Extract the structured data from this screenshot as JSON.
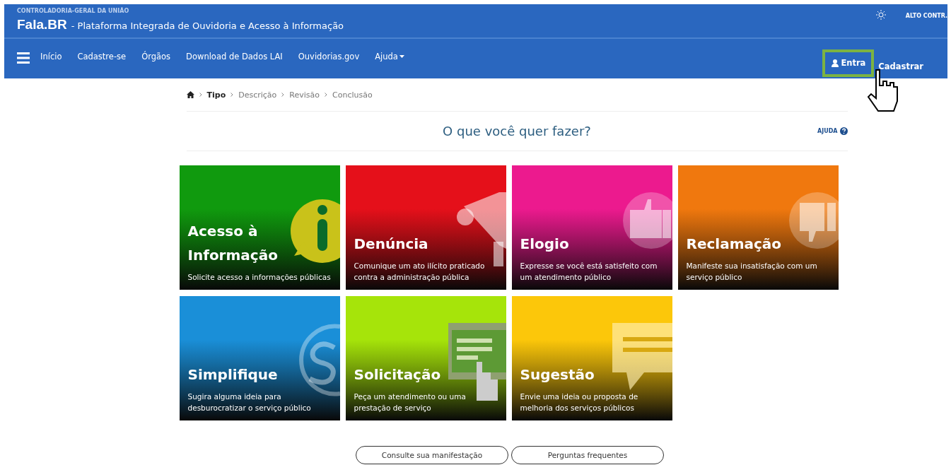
{
  "header": {
    "agency": "CONTROLADORIA-GERAL DA UNIÃO",
    "brand": "Fala.BR",
    "subtitle": "- Plataforma Integrada de Ouvidoria e Acesso à Informação",
    "contrast": "ALTO CONTR."
  },
  "nav": {
    "items": [
      {
        "label": "Início",
        "dropdown": false
      },
      {
        "label": "Cadastre-se",
        "dropdown": false
      },
      {
        "label": "Órgãos",
        "dropdown": false
      },
      {
        "label": "Download de Dados LAI",
        "dropdown": false
      },
      {
        "label": "Ouvidorias.gov",
        "dropdown": false
      },
      {
        "label": "Ajuda",
        "dropdown": true
      }
    ],
    "login": "Entra",
    "register": "Cadastrar"
  },
  "breadcrumb": [
    {
      "label": "Tipo",
      "selected": true
    },
    {
      "label": "Descrição",
      "selected": false
    },
    {
      "label": "Revisão",
      "selected": false
    },
    {
      "label": "Conclusão",
      "selected": false
    }
  ],
  "heading": "O que você quer fazer?",
  "help": "AJUDA",
  "tiles": [
    {
      "kind": "info",
      "title": "Acesso à Informação",
      "text": "Solicite acesso a informações públicas",
      "color": "#109a0e"
    },
    {
      "kind": "megaphone",
      "title": "Denúncia",
      "text": "Comunique um ato ilícito praticado contra a administração pública",
      "color": "#e5101a"
    },
    {
      "kind": "like",
      "title": "Elogio",
      "text": "Expresse se você está satisfeito com um atendimento público",
      "color": "#ec1a8e"
    },
    {
      "kind": "dislike",
      "title": "Reclamação",
      "text": "Manifeste sua insatisfação com um serviço público",
      "color": "#f0780e"
    },
    {
      "kind": "simplify",
      "title": "Simplifique",
      "text": "Sugira alguma ideia para desburocratizar o serviço público",
      "color": "#1a8fd8"
    },
    {
      "kind": "screen",
      "title": "Solicitação",
      "text": "Peça um atendimento ou uma prestação de serviço",
      "color": "#a6e40a"
    },
    {
      "kind": "bubble",
      "title": "Sugestão",
      "text": "Envie uma ideia ou proposta de melhoria dos serviços públicos",
      "color": "#fcc70a"
    }
  ],
  "buttons": [
    "Consulte sua manifestação",
    "Perguntas frequentes"
  ]
}
